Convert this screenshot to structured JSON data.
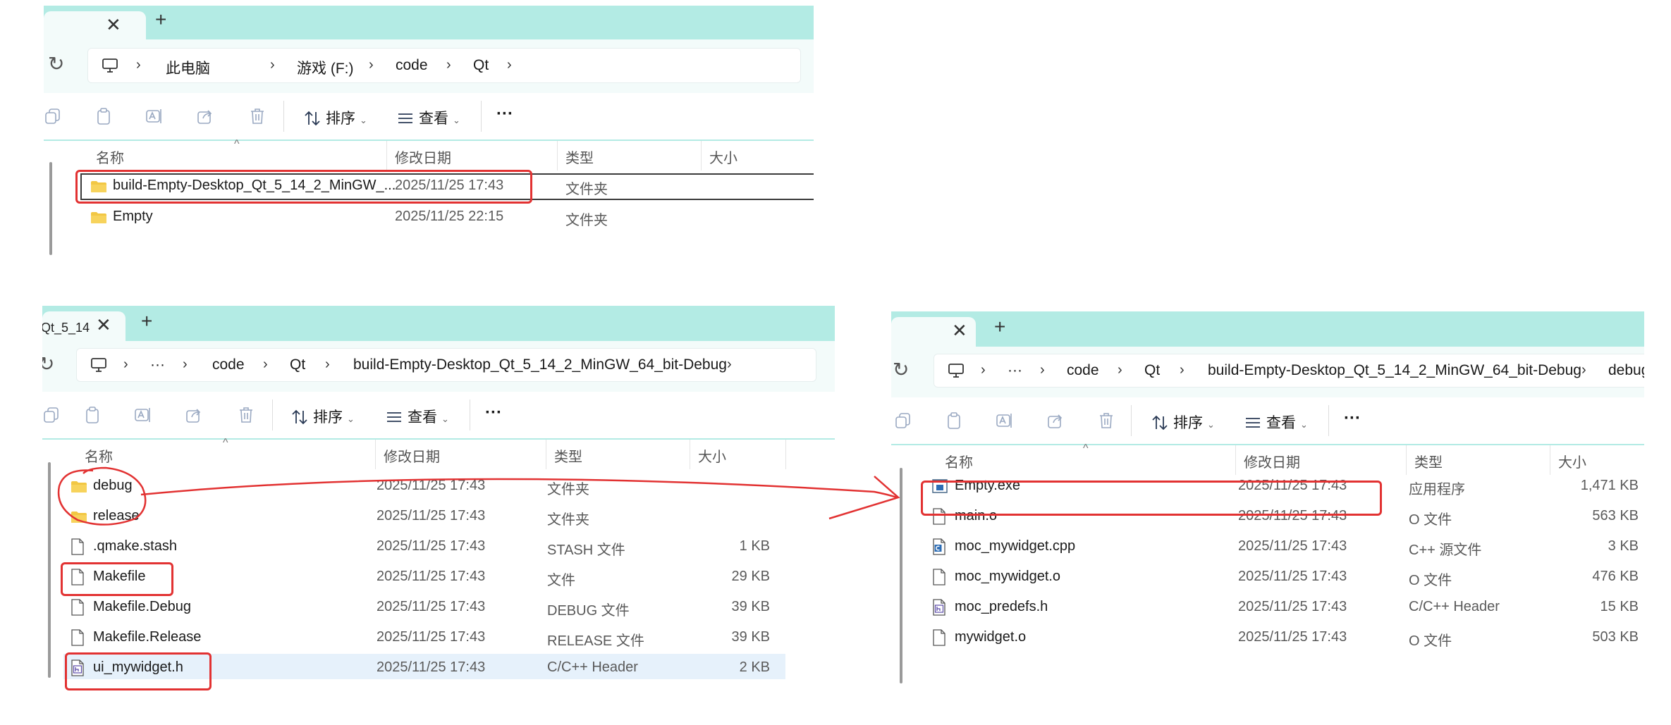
{
  "window1": {
    "tab": {
      "close": "✕",
      "new": "+"
    },
    "breadcrumb": [
      "此电脑",
      "游戏 (F:)",
      "code",
      "Qt"
    ],
    "toolbar": {
      "sort": "排序",
      "view": "查看",
      "more": "···"
    },
    "columns": {
      "name": "名称",
      "date": "修改日期",
      "type": "类型",
      "size": "大小"
    },
    "rows": [
      {
        "name": "build-Empty-Desktop_Qt_5_14_2_MinGW_...",
        "date": "2025/11/25 17:43",
        "type": "文件夹",
        "size": "",
        "icon": "folder-icon"
      },
      {
        "name": "Empty",
        "date": "2025/11/25 22:15",
        "type": "文件夹",
        "size": "",
        "icon": "folder-icon"
      }
    ]
  },
  "window2": {
    "tab": {
      "title": "Qt_5_14",
      "close": "✕",
      "new": "+"
    },
    "breadcrumb": [
      "···",
      "code",
      "Qt",
      "build-Empty-Desktop_Qt_5_14_2_MinGW_64_bit-Debug"
    ],
    "toolbar": {
      "sort": "排序",
      "view": "查看",
      "more": "···"
    },
    "columns": {
      "name": "名称",
      "date": "修改日期",
      "type": "类型",
      "size": "大小"
    },
    "rows": [
      {
        "name": "debug",
        "date": "2025/11/25 17:43",
        "type": "文件夹",
        "size": "",
        "icon": "folder-icon"
      },
      {
        "name": "release",
        "date": "2025/11/25 17:43",
        "type": "文件夹",
        "size": "",
        "icon": "folder-icon"
      },
      {
        "name": ".qmake.stash",
        "date": "2025/11/25 17:43",
        "type": "STASH 文件",
        "size": "1 KB",
        "icon": "file-icon"
      },
      {
        "name": "Makefile",
        "date": "2025/11/25 17:43",
        "type": "文件",
        "size": "29 KB",
        "icon": "file-icon"
      },
      {
        "name": "Makefile.Debug",
        "date": "2025/11/25 17:43",
        "type": "DEBUG 文件",
        "size": "39 KB",
        "icon": "file-icon"
      },
      {
        "name": "Makefile.Release",
        "date": "2025/11/25 17:43",
        "type": "RELEASE 文件",
        "size": "39 KB",
        "icon": "file-icon"
      },
      {
        "name": "ui_mywidget.h",
        "date": "2025/11/25 17:43",
        "type": "C/C++ Header",
        "size": "2 KB",
        "icon": "header-file-icon"
      }
    ]
  },
  "window3": {
    "tab": {
      "close": "✕",
      "new": "+"
    },
    "breadcrumb": [
      "···",
      "code",
      "Qt",
      "build-Empty-Desktop_Qt_5_14_2_MinGW_64_bit-Debug",
      "debug"
    ],
    "toolbar": {
      "sort": "排序",
      "view": "查看",
      "more": "···"
    },
    "columns": {
      "name": "名称",
      "date": "修改日期",
      "type": "类型",
      "size": "大小"
    },
    "rows": [
      {
        "name": "Empty.exe",
        "date": "2025/11/25 17:43",
        "type": "应用程序",
        "size": "1,471 KB",
        "icon": "exe-icon"
      },
      {
        "name": "main.o",
        "date": "2025/11/25 17:43",
        "type": "O 文件",
        "size": "563 KB",
        "icon": "file-icon"
      },
      {
        "name": "moc_mywidget.cpp",
        "date": "2025/11/25 17:43",
        "type": "C++ 源文件",
        "size": "3 KB",
        "icon": "cpp-file-icon"
      },
      {
        "name": "moc_mywidget.o",
        "date": "2025/11/25 17:43",
        "type": "O 文件",
        "size": "476 KB",
        "icon": "file-icon"
      },
      {
        "name": "moc_predefs.h",
        "date": "2025/11/25 17:43",
        "type": "C/C++ Header",
        "size": "15 KB",
        "icon": "header-file-icon"
      },
      {
        "name": "mywidget.o",
        "date": "2025/11/25 17:43",
        "type": "O 文件",
        "size": "503 KB",
        "icon": "file-icon"
      }
    ]
  },
  "colors": {
    "tab_bar": "#b3ebe4",
    "annotation": "#e23232",
    "selection": "#e6f1fb",
    "folder": "#f2c744"
  }
}
